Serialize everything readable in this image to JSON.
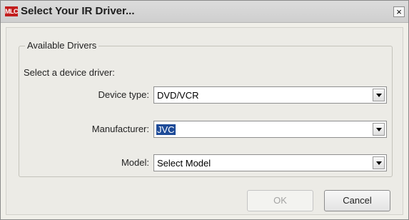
{
  "window": {
    "title": "Select Your IR Driver...",
    "logo_text": "MLC",
    "close_glyph": "×"
  },
  "group": {
    "legend": "Available Drivers",
    "prompt": "Select a device driver:"
  },
  "fields": {
    "device_type": {
      "label": "Device type:",
      "value": "DVD/VCR"
    },
    "manufacturer": {
      "label": "Manufacturer:",
      "value": "JVC"
    },
    "model": {
      "label": "Model:",
      "value": "Select Model"
    }
  },
  "buttons": {
    "ok": "OK",
    "cancel": "Cancel"
  }
}
